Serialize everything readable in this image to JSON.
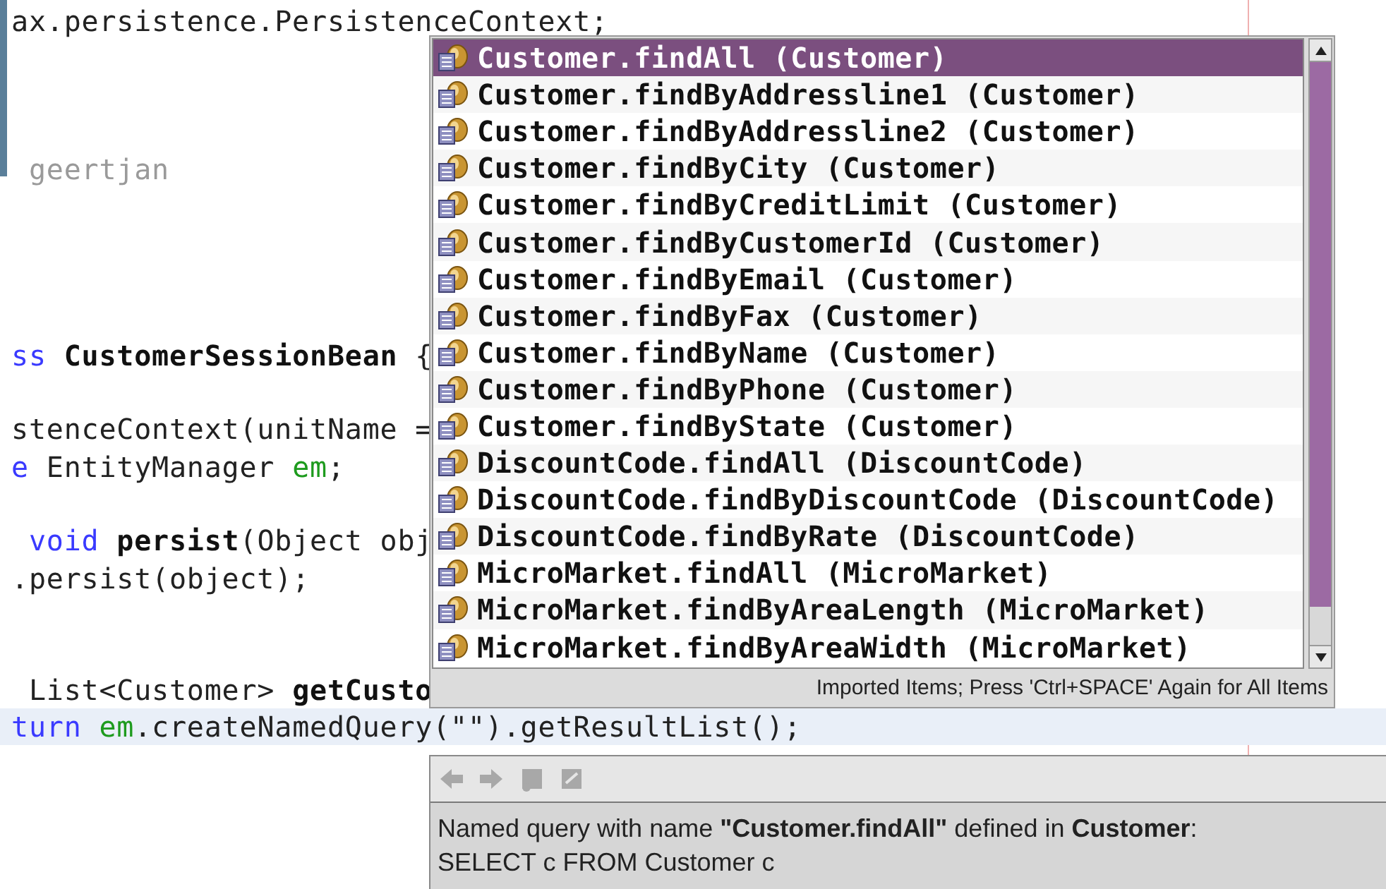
{
  "editor": {
    "lines": [
      {
        "kind": "code",
        "highlighted": false,
        "tokens": [
          {
            "kind": "plain",
            "text": "ax.persistence.PersistenceContext;"
          }
        ]
      },
      {
        "kind": "blank"
      },
      {
        "kind": "blank"
      },
      {
        "kind": "blank"
      },
      {
        "kind": "code",
        "highlighted": false,
        "tokens": [
          {
            "kind": "comment",
            "text": " geertjan"
          }
        ]
      },
      {
        "kind": "blank"
      },
      {
        "kind": "blank"
      },
      {
        "kind": "blank"
      },
      {
        "kind": "blank"
      },
      {
        "kind": "code",
        "highlighted": false,
        "tokens": [
          {
            "kind": "keyword",
            "text": "ss"
          },
          {
            "kind": "bold",
            "text": " CustomerSessionBean"
          },
          {
            "kind": "plain",
            "text": " {"
          }
        ]
      },
      {
        "kind": "blank"
      },
      {
        "kind": "code",
        "highlighted": false,
        "tokens": [
          {
            "kind": "plain",
            "text": "stenceContext(unitName ="
          }
        ]
      },
      {
        "kind": "code",
        "highlighted": false,
        "tokens": [
          {
            "kind": "keyword",
            "text": "e"
          },
          {
            "kind": "plain",
            "text": " EntityManager "
          },
          {
            "kind": "field",
            "text": "em"
          },
          {
            "kind": "plain",
            "text": ";"
          }
        ]
      },
      {
        "kind": "blank"
      },
      {
        "kind": "code",
        "highlighted": false,
        "tokens": [
          {
            "kind": "keyword",
            "text": " void "
          },
          {
            "kind": "bold",
            "text": "persist"
          },
          {
            "kind": "plain",
            "text": "(Object obj"
          }
        ]
      },
      {
        "kind": "code",
        "highlighted": false,
        "tokens": [
          {
            "kind": "plain",
            "text": ".persist(object);"
          }
        ]
      },
      {
        "kind": "blank"
      },
      {
        "kind": "blank"
      },
      {
        "kind": "code",
        "highlighted": false,
        "tokens": [
          {
            "kind": "plain",
            "text": " List<Customer> "
          },
          {
            "kind": "bold",
            "text": "getCusto"
          }
        ]
      },
      {
        "kind": "code",
        "highlighted": true,
        "tokens": [
          {
            "kind": "keyword",
            "text": "turn "
          },
          {
            "kind": "field",
            "text": "em"
          },
          {
            "kind": "plain",
            "text": ".createNamedQuery(\"\").getResultList();"
          }
        ]
      }
    ]
  },
  "completion": {
    "items": [
      {
        "label": "Customer.findAll (Customer)",
        "selected": true
      },
      {
        "label": "Customer.findByAddressline1 (Customer)",
        "selected": false
      },
      {
        "label": "Customer.findByAddressline2 (Customer)",
        "selected": false
      },
      {
        "label": "Customer.findByCity (Customer)",
        "selected": false
      },
      {
        "label": "Customer.findByCreditLimit (Customer)",
        "selected": false
      },
      {
        "label": "Customer.findByCustomerId (Customer)",
        "selected": false
      },
      {
        "label": "Customer.findByEmail (Customer)",
        "selected": false
      },
      {
        "label": "Customer.findByFax (Customer)",
        "selected": false
      },
      {
        "label": "Customer.findByName (Customer)",
        "selected": false
      },
      {
        "label": "Customer.findByPhone (Customer)",
        "selected": false
      },
      {
        "label": "Customer.findByState (Customer)",
        "selected": false
      },
      {
        "label": "DiscountCode.findAll (DiscountCode)",
        "selected": false
      },
      {
        "label": "DiscountCode.findByDiscountCode (DiscountCode)",
        "selected": false
      },
      {
        "label": "DiscountCode.findByRate (DiscountCode)",
        "selected": false
      },
      {
        "label": "MicroMarket.findAll (MicroMarket)",
        "selected": false
      },
      {
        "label": "MicroMarket.findByAreaLength (MicroMarket)",
        "selected": false
      },
      {
        "label": "MicroMarket.findByAreaWidth (MicroMarket)",
        "selected": false
      }
    ],
    "footer": "Imported Items; Press 'Ctrl+SPACE' Again for All Items"
  },
  "documentation": {
    "toolbar": [
      {
        "kind": "back",
        "disabled": true
      },
      {
        "kind": "forward",
        "disabled": true
      },
      {
        "kind": "browser",
        "disabled": true
      },
      {
        "kind": "source",
        "disabled": true
      }
    ],
    "text": [
      "Named query with name **\"Customer.findAll\"** defined in **Customer**:",
      "SELECT c FROM Customer c"
    ]
  }
}
